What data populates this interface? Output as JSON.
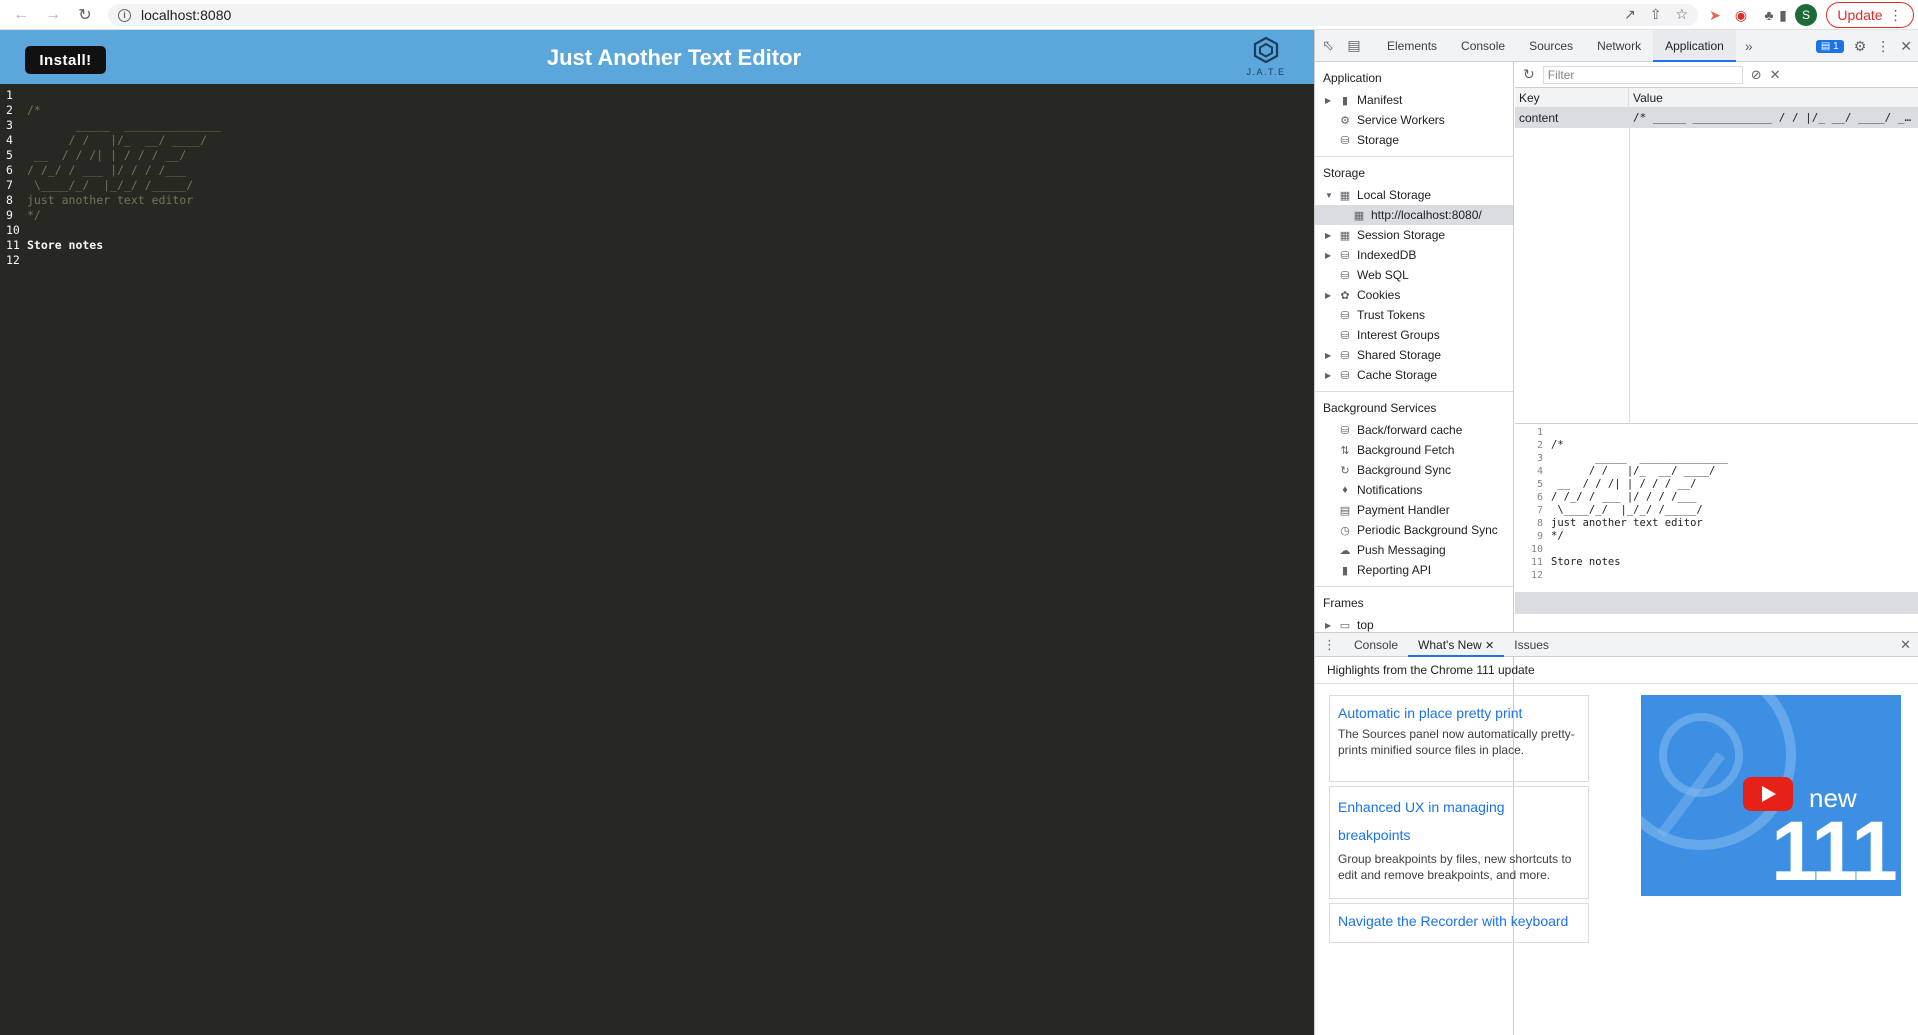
{
  "browser": {
    "url": "localhost:8080",
    "profile_initial": "S",
    "update_label": "Update"
  },
  "app": {
    "install_label": "Install!",
    "title": "Just Another Text Editor",
    "logo_text": "J.A.T.E",
    "lines": [
      {
        "n": "1",
        "t": ""
      },
      {
        "n": "2",
        "t": "/*"
      },
      {
        "n": "3",
        "t": "       _____  ______________"
      },
      {
        "n": "4",
        "t": "      / /   |/_  __/ ____/"
      },
      {
        "n": "5",
        "t": " __  / / /| | / / / __/"
      },
      {
        "n": "6",
        "t": "/ /_/ / ___ |/ / / /___"
      },
      {
        "n": "7",
        "t": " \\____/_/  |_/_/ /_____/"
      },
      {
        "n": "8",
        "t": "just another text editor"
      },
      {
        "n": "9",
        "t": "*/"
      },
      {
        "n": "10",
        "t": ""
      },
      {
        "n": "11",
        "t": "Store notes"
      },
      {
        "n": "12",
        "t": ""
      }
    ]
  },
  "devtools": {
    "tabs": [
      "Elements",
      "Console",
      "Sources",
      "Network",
      "Application"
    ],
    "active_tab": "Application",
    "issues_count": "1",
    "sidebar": {
      "application_title": "Application",
      "application_items": [
        "Manifest",
        "Service Workers",
        "Storage"
      ],
      "storage_title": "Storage",
      "local_storage": "Local Storage",
      "local_storage_origin": "http://localhost:8080/",
      "storage_items": [
        "Session Storage",
        "IndexedDB",
        "Web SQL",
        "Cookies",
        "Trust Tokens",
        "Interest Groups",
        "Shared Storage",
        "Cache Storage"
      ],
      "background_title": "Background Services",
      "background_items": [
        "Back/forward cache",
        "Background Fetch",
        "Background Sync",
        "Notifications",
        "Payment Handler",
        "Periodic Background Sync",
        "Push Messaging",
        "Reporting API"
      ],
      "frames_title": "Frames",
      "frames_top": "top"
    },
    "filter_placeholder": "Filter",
    "table": {
      "key_header": "Key",
      "value_header": "Value",
      "rows": [
        {
          "key": "content",
          "value": "/* _____ ____________ / / |/_ __/ ____/ __ / / /| | / / / __/ / /_/ / ___ |/ / / /___ \\____/_/ |_/_/ /_____/ ..."
        }
      ]
    },
    "drawer": {
      "tabs": [
        "Console",
        "What's New",
        "Issues"
      ],
      "active_tab": "What's New",
      "highlights": "Highlights from the Chrome 111 update",
      "cards": [
        {
          "title": "Automatic in place pretty print",
          "desc": "The Sources panel now automatically pretty-prints minified source files in place."
        },
        {
          "title": "Enhanced UX in managing breakpoints",
          "desc": "Group breakpoints by files, new shortcuts to edit and remove breakpoints, and more."
        },
        {
          "title": "Navigate the Recorder with keyboard",
          "desc": ""
        }
      ],
      "video_new": "new",
      "video_version": "111"
    }
  }
}
